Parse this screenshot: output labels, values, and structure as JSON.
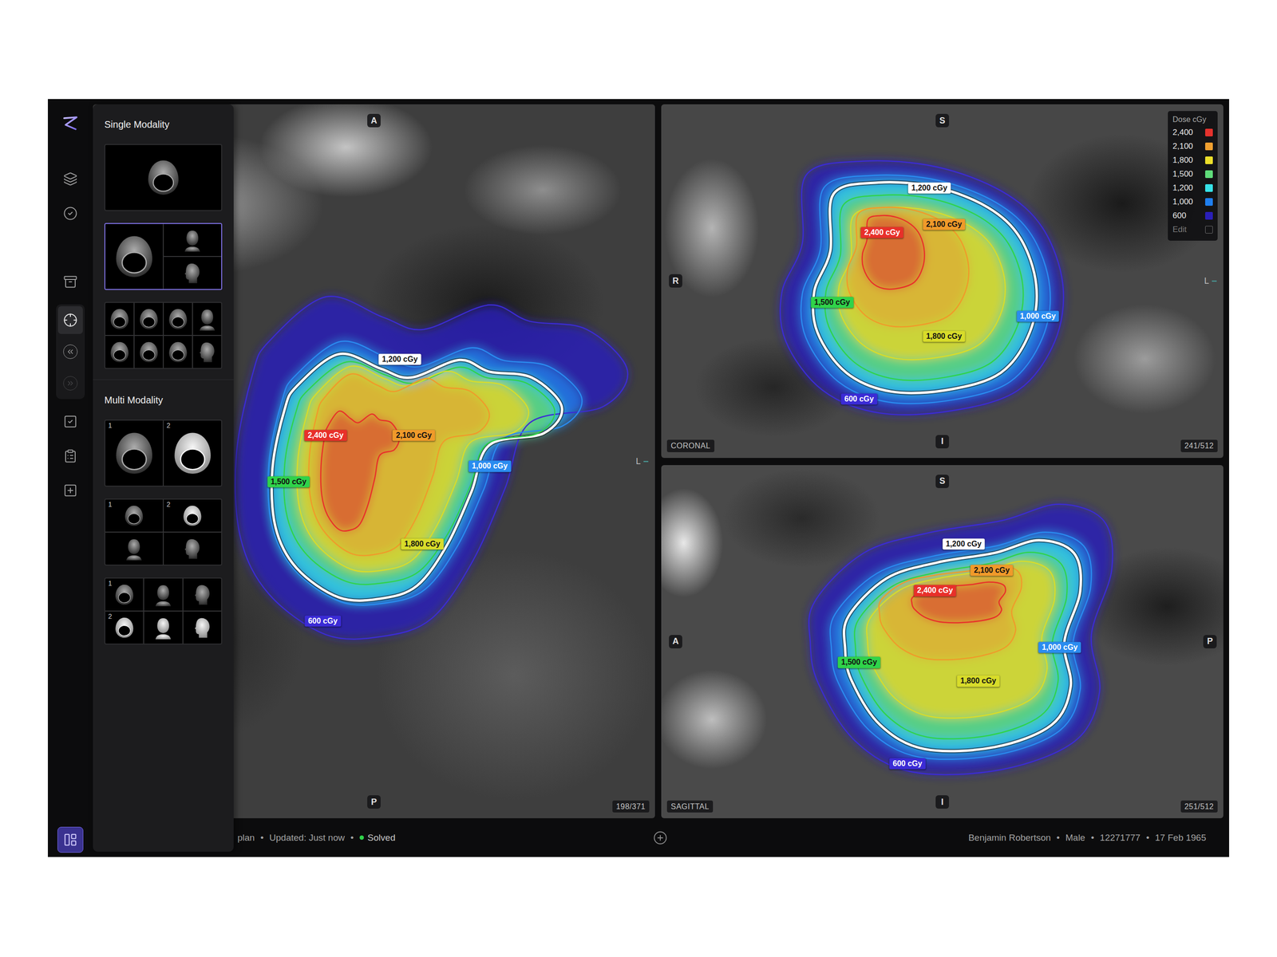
{
  "rail": {
    "groups": [
      {
        "boxed": false,
        "items": [
          {
            "selected": false,
            "disabled": false
          },
          {
            "selected": false,
            "disabled": false
          }
        ]
      },
      {
        "boxed": false,
        "items": [
          {
            "selected": false,
            "disabled": false
          }
        ]
      },
      {
        "boxed": true,
        "items": [
          {
            "selected": true,
            "disabled": false
          },
          {
            "selected": false,
            "disabled": false
          },
          {
            "selected": false,
            "disabled": true
          }
        ]
      },
      {
        "boxed": false,
        "items": [
          {
            "selected": false,
            "disabled": false
          },
          {
            "selected": false,
            "disabled": false
          },
          {
            "selected": false,
            "disabled": false
          }
        ]
      }
    ],
    "footer": {
      "selected": true
    }
  },
  "layout_panel": {
    "sections": [
      {
        "title": "Single Modality",
        "layouts": [
          {
            "kind": "one",
            "selected": false,
            "tiles": [
              {
                "kind": "axial"
              }
            ]
          },
          {
            "kind": "main-stack",
            "selected": true,
            "tiles": [
              {
                "kind": "axial"
              },
              {
                "kind": "front"
              },
              {
                "kind": "side"
              }
            ]
          },
          {
            "kind": "grid-4x2",
            "selected": false,
            "tiles": [
              {
                "kind": "axial"
              },
              {
                "kind": "axial"
              },
              {
                "kind": "axial"
              },
              {
                "kind": "front"
              },
              {
                "kind": "axial"
              },
              {
                "kind": "axial"
              },
              {
                "kind": "axial"
              },
              {
                "kind": "side"
              }
            ]
          }
        ]
      },
      {
        "title": "Multi Modality",
        "layouts": [
          {
            "kind": "pair",
            "selected": false,
            "tiles": [
              {
                "kind": "axial",
                "label": "1"
              },
              {
                "kind": "axial-bright",
                "label": "2"
              }
            ]
          },
          {
            "kind": "grid-2x2",
            "selected": false,
            "tiles": [
              {
                "kind": "axial",
                "label": "1"
              },
              {
                "kind": "axial-bright",
                "label": "2"
              },
              {
                "kind": "front"
              },
              {
                "kind": "side"
              }
            ]
          },
          {
            "kind": "grid-3x2",
            "selected": false,
            "tiles": [
              {
                "kind": "axial",
                "label": "1"
              },
              {
                "kind": "front"
              },
              {
                "kind": "side"
              },
              {
                "kind": "axial-bright",
                "label": "2"
              },
              {
                "kind": "front-bright"
              },
              {
                "kind": "side-bright"
              }
            ]
          }
        ]
      }
    ]
  },
  "viewports": [
    {
      "markers": {
        "top": {
          "label": "A",
          "boxed": true
        },
        "bottom": {
          "label": "P",
          "boxed": true
        },
        "right": {
          "label": "L",
          "boxed": false
        }
      },
      "plane": "",
      "slice": "198/371",
      "legend": false,
      "isodoses": [
        {
          "label": "600 cGy",
          "color": "#3b2bd6",
          "emphasis": false
        },
        {
          "label": "1,000 cGy",
          "color": "#2a8cf0",
          "emphasis": false
        },
        {
          "label": "1,200 cGy",
          "color": "#ffffff",
          "emphasis": true
        },
        {
          "label": "1,500 cGy",
          "color": "#2fd34a",
          "emphasis": false
        },
        {
          "label": "1,800 cGy",
          "color": "#d8dc2a",
          "emphasis": false
        },
        {
          "label": "2,100 cGy",
          "color": "#f09a2a",
          "emphasis": false
        },
        {
          "label": "2,400 cGy",
          "color": "#e8302a",
          "emphasis": false
        }
      ]
    },
    {
      "markers": {
        "top": {
          "label": "S",
          "boxed": true
        },
        "bottom": {
          "label": "I",
          "boxed": true
        },
        "left": {
          "label": "R",
          "boxed": true
        },
        "right": {
          "label": "L",
          "boxed": false
        }
      },
      "plane": "CORONAL",
      "slice": "241/512",
      "legend": true,
      "isodoses": [
        {
          "label": "600 cGy",
          "color": "#3b2bd6",
          "emphasis": false
        },
        {
          "label": "1,000 cGy",
          "color": "#2a8cf0",
          "emphasis": false
        },
        {
          "label": "1,200 cGy",
          "color": "#ffffff",
          "emphasis": true
        },
        {
          "label": "1,500 cGy",
          "color": "#2fd34a",
          "emphasis": false
        },
        {
          "label": "1,800 cGy",
          "color": "#d8dc2a",
          "emphasis": false
        },
        {
          "label": "2,100 cGy",
          "color": "#f09a2a",
          "emphasis": false
        },
        {
          "label": "2,400 cGy",
          "color": "#e8302a",
          "emphasis": false
        }
      ]
    },
    {
      "markers": {
        "top": {
          "label": "S",
          "boxed": true
        },
        "bottom": {
          "label": "I",
          "boxed": true
        },
        "left": {
          "label": "A",
          "boxed": true
        },
        "right": {
          "label": "P",
          "boxed": true
        }
      },
      "plane": "SAGITTAL",
      "slice": "251/512",
      "legend": false,
      "isodoses": [
        {
          "label": "600 cGy",
          "color": "#3b2bd6",
          "emphasis": false
        },
        {
          "label": "1,000 cGy",
          "color": "#2a8cf0",
          "emphasis": false
        },
        {
          "label": "1,200 cGy",
          "color": "#ffffff",
          "emphasis": true
        },
        {
          "label": "1,500 cGy",
          "color": "#2fd34a",
          "emphasis": false
        },
        {
          "label": "1,800 cGy",
          "color": "#d8dc2a",
          "emphasis": false
        },
        {
          "label": "2,100 cGy",
          "color": "#f09a2a",
          "emphasis": false
        },
        {
          "label": "2,400 cGy",
          "color": "#e8302a",
          "emphasis": false
        }
      ]
    }
  ],
  "legend": {
    "title": "Dose cGy",
    "items": [
      {
        "value": "2,400",
        "color": "#e5322d"
      },
      {
        "value": "2,100",
        "color": "#f0a030"
      },
      {
        "value": "1,800",
        "color": "#ecdf2a"
      },
      {
        "value": "1,500",
        "color": "#5fdc7a"
      },
      {
        "value": "1,200",
        "color": "#36e2e8"
      },
      {
        "value": "1,000",
        "color": "#1f7ff0"
      },
      {
        "value": "600",
        "color": "#2a1fb8"
      }
    ],
    "edit": "Edit"
  },
  "status_bar": {
    "plan": "plan",
    "separator": "•",
    "updated": "Updated: Just now",
    "status": {
      "label": "Solved",
      "color": "#2fd34a"
    },
    "patient": [
      "Benjamin Robertson",
      "Male",
      "12271777",
      "17 Feb 1965"
    ]
  }
}
